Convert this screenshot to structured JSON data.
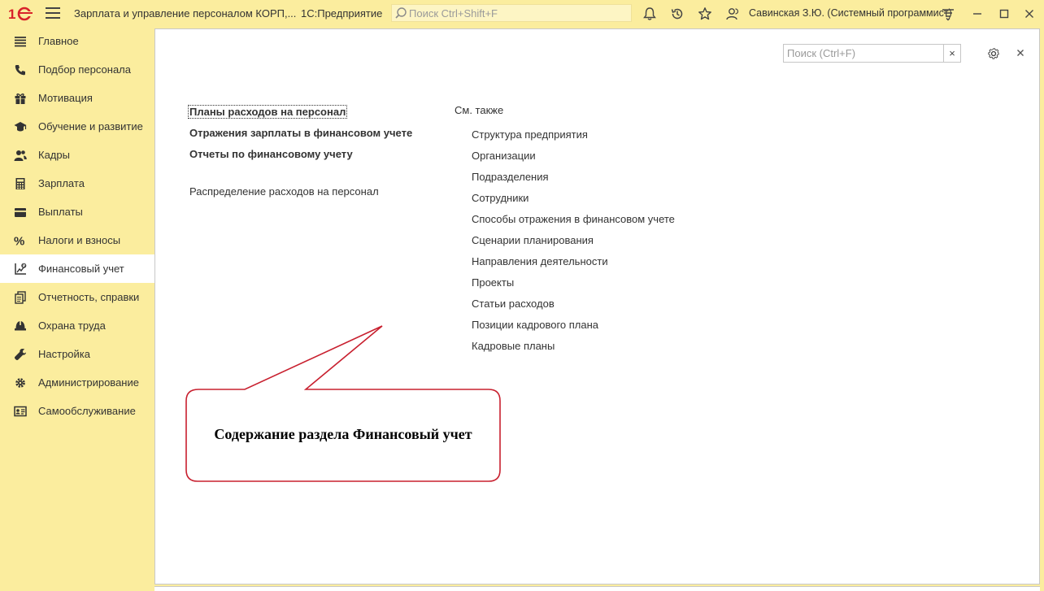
{
  "titlebar": {
    "logo_text": "1С",
    "app_title": "Зарплата и управление персоналом КОРП,...",
    "platform": "1С:Предприятие",
    "search_placeholder": "Поиск Ctrl+Shift+F",
    "user": "Савинская З.Ю. (Системный программист)"
  },
  "sidebar": {
    "items": [
      {
        "label": "Главное",
        "icon": "list-icon"
      },
      {
        "label": "Подбор персонала",
        "icon": "phone-icon"
      },
      {
        "label": "Мотивация",
        "icon": "gift-icon"
      },
      {
        "label": "Обучение и развитие",
        "icon": "graduation-cap-icon"
      },
      {
        "label": "Кадры",
        "icon": "people-icon"
      },
      {
        "label": "Зарплата",
        "icon": "calculator-icon"
      },
      {
        "label": "Выплаты",
        "icon": "wallet-icon"
      },
      {
        "label": "Налоги и взносы",
        "icon": "percent-icon"
      },
      {
        "label": "Финансовый учет",
        "icon": "finance-chart-icon",
        "active": true
      },
      {
        "label": "Отчетность, справки",
        "icon": "documents-icon"
      },
      {
        "label": "Охрана труда",
        "icon": "helmet-icon"
      },
      {
        "label": "Настройка",
        "icon": "wrench-icon"
      },
      {
        "label": "Администрирование",
        "icon": "gear-people-icon"
      },
      {
        "label": "Самообслуживание",
        "icon": "id-card-icon"
      }
    ]
  },
  "content": {
    "search_placeholder": "Поиск (Ctrl+F)",
    "clear_symbol": "×",
    "main_links": [
      "Планы расходов на персонал",
      "Отражения зарплаты в финансовом учете",
      "Отчеты по финансовому учету"
    ],
    "secondary_links": [
      "Распределение расходов на персонал"
    ],
    "see_also_title": "См. также",
    "see_also_links": [
      "Структура предприятия",
      "Организации",
      "Подразделения",
      "Сотрудники",
      "Способы отражения в финансовом учете",
      "Сценарии планирования",
      "Направления деятельности",
      "Проекты",
      "Статьи расходов",
      "Позиции кадрового плана",
      "Кадровые планы"
    ]
  },
  "callout": {
    "text": "Содержание раздела Финансовый учет",
    "border_color": "#c8202f"
  },
  "colors": {
    "sidebar_bg": "#fbed9e",
    "logo_red": "#d8232a",
    "content_bg": "#ffffff"
  }
}
